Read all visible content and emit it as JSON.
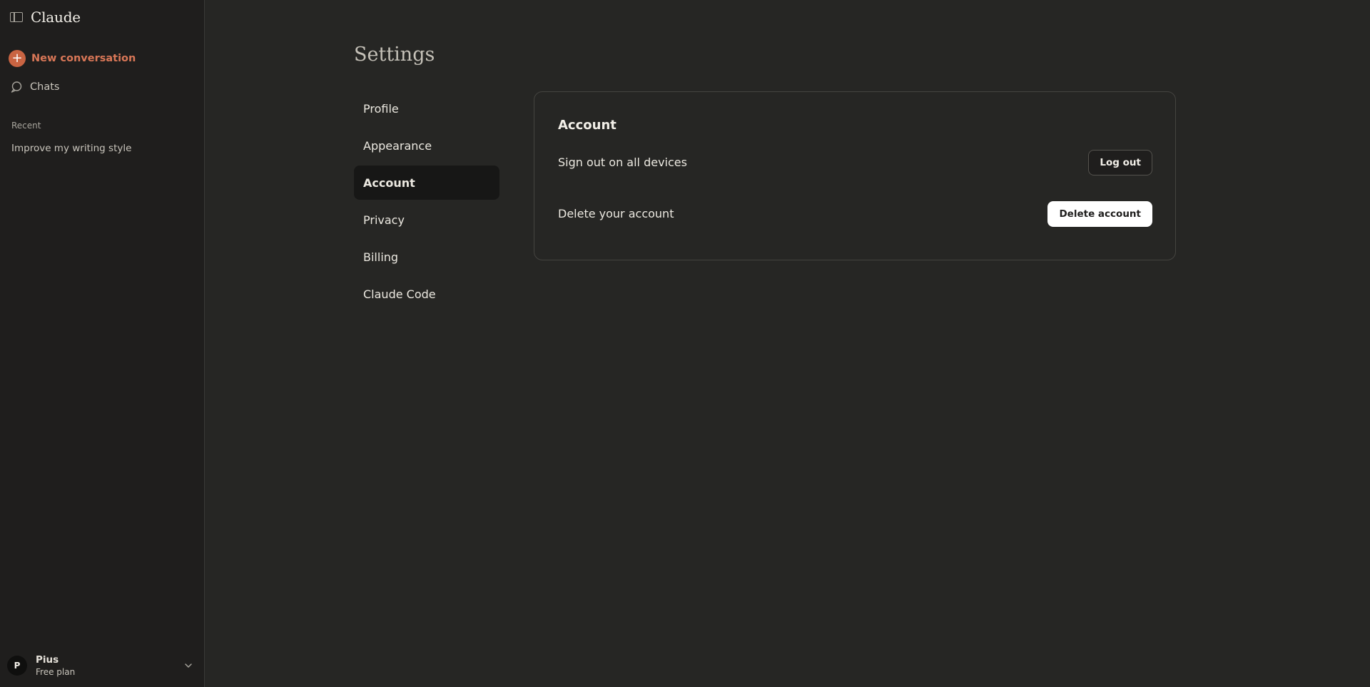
{
  "app": {
    "brand": "Claude"
  },
  "sidebar": {
    "new_conversation": "New conversation",
    "chats": "Chats",
    "recent_heading": "Recent",
    "recent_items": [
      "Improve my writing style"
    ],
    "user": {
      "initial": "P",
      "name": "Pius",
      "plan": "Free plan"
    }
  },
  "settings": {
    "title": "Settings",
    "nav": [
      "Profile",
      "Appearance",
      "Account",
      "Privacy",
      "Billing",
      "Claude Code"
    ],
    "active_nav": "Account",
    "account": {
      "heading": "Account",
      "rows": [
        {
          "label": "Sign out on all devices",
          "button": "Log out"
        },
        {
          "label": "Delete your account",
          "button": "Delete account"
        }
      ]
    }
  },
  "colors": {
    "accent": "#d97757",
    "accent_fill": "#c96442",
    "background": "#262624",
    "sidebar": "#1f1e1d"
  }
}
